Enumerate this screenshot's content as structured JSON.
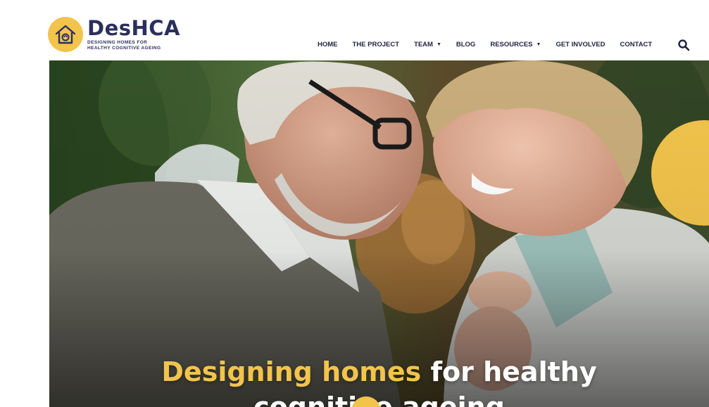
{
  "brand": {
    "name": "DesHCA",
    "tagline_line1": "DESIGNING HOMES FOR",
    "tagline_line2": "HEALTHY COGNITIVE AGEING"
  },
  "nav": {
    "items": [
      {
        "label": "HOME",
        "active": true,
        "has_dropdown": false
      },
      {
        "label": "THE PROJECT",
        "active": false,
        "has_dropdown": false
      },
      {
        "label": "TEAM",
        "active": false,
        "has_dropdown": true
      },
      {
        "label": "BLOG",
        "active": false,
        "has_dropdown": false
      },
      {
        "label": "RESOURCES",
        "active": false,
        "has_dropdown": true
      },
      {
        "label": "GET INVOLVED",
        "active": false,
        "has_dropdown": false
      },
      {
        "label": "CONTACT",
        "active": false,
        "has_dropdown": false
      }
    ],
    "search_icon": "search-icon"
  },
  "hero": {
    "title_highlight": "Designing homes",
    "title_rest_line1": " for healthy",
    "title_line2": "cognitive ageing"
  },
  "colors": {
    "accent": "#f2c44c",
    "navy": "#2b2f5e",
    "nav_text": "#1f2340"
  }
}
